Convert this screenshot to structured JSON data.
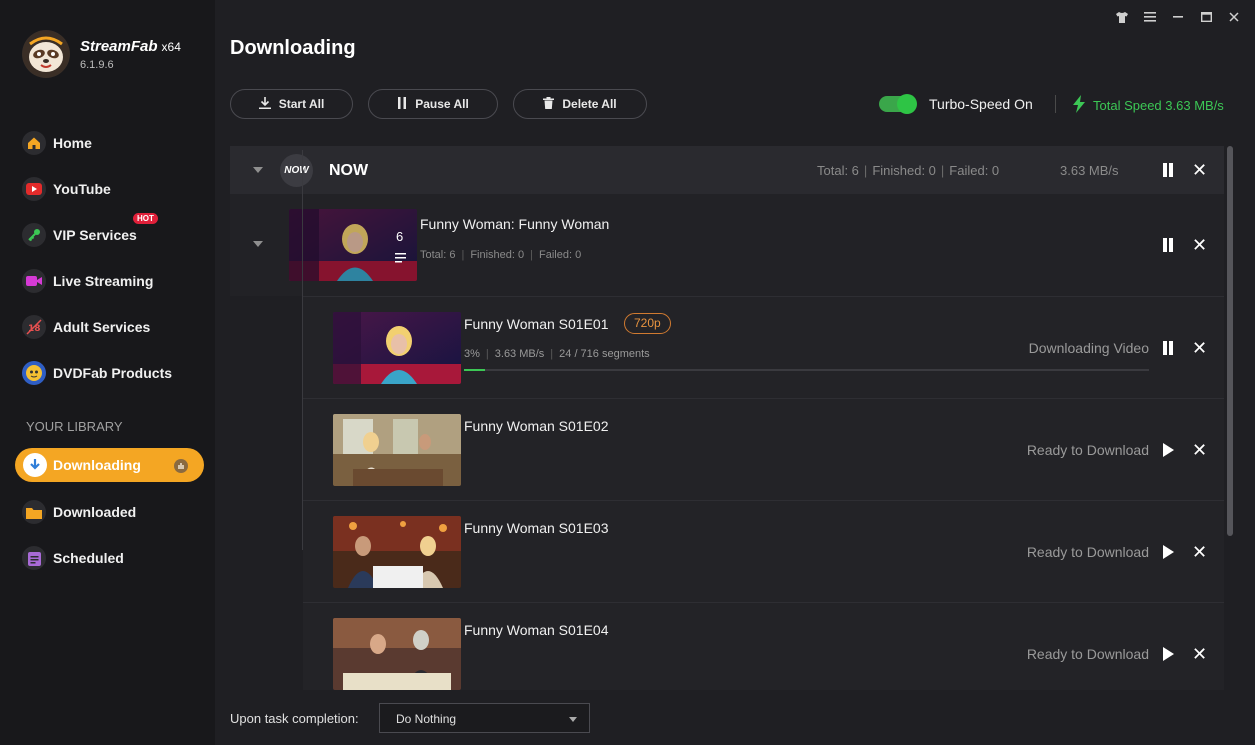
{
  "app": {
    "brand": "StreamFab",
    "arch": "x64",
    "version": "6.1.9.6"
  },
  "window_controls": [
    "shirt-icon",
    "menu-icon",
    "minimize-icon",
    "maximize-icon",
    "close-icon"
  ],
  "sidebar": {
    "items": [
      {
        "label": "Home",
        "icon": "home-icon"
      },
      {
        "label": "YouTube",
        "icon": "youtube-icon"
      },
      {
        "label": "VIP Services",
        "icon": "key-icon",
        "badge": "HOT"
      },
      {
        "label": "Live Streaming",
        "icon": "camera-icon"
      },
      {
        "label": "Adult Services",
        "icon": "adult-icon"
      },
      {
        "label": "DVDFab Products",
        "icon": "dvdfab-icon"
      }
    ],
    "library_title": "YOUR LIBRARY",
    "library": [
      {
        "label": "Downloading",
        "icon": "download-icon",
        "active": true
      },
      {
        "label": "Downloaded",
        "icon": "folder-icon"
      },
      {
        "label": "Scheduled",
        "icon": "calendar-icon"
      }
    ]
  },
  "main": {
    "title": "Downloading",
    "toolbar": {
      "start_all": "Start All",
      "pause_all": "Pause All",
      "delete_all": "Delete All"
    },
    "turbo_label": "Turbo-Speed On",
    "turbo_on": true,
    "total_speed": "Total Speed 3.63 MB/s"
  },
  "group": {
    "name": "NOW",
    "logo_text": "NOW",
    "total": "Total: 6",
    "finished": "Finished: 0",
    "failed": "Failed: 0",
    "speed": "3.63 MB/s"
  },
  "series": {
    "title": "Funny Woman: Funny Woman",
    "count": "6",
    "total": "Total: 6",
    "finished": "Finished: 0",
    "failed": "Failed: 0"
  },
  "episodes": [
    {
      "title": "Funny Woman S01E01",
      "quality": "720p",
      "percent": "3%",
      "speed": "3.63 MB/s",
      "segments": "24 / 716 segments",
      "progress": 0.03,
      "status": "Downloading Video",
      "action": "pause"
    },
    {
      "title": "Funny Woman S01E02",
      "status": "Ready to Download",
      "action": "play"
    },
    {
      "title": "Funny Woman S01E03",
      "status": "Ready to Download",
      "action": "play"
    },
    {
      "title": "Funny Woman S01E04",
      "status": "Ready to Download",
      "action": "play"
    }
  ],
  "footer": {
    "label": "Upon task completion:",
    "selected": "Do Nothing"
  },
  "colors": {
    "accent": "#f4a623",
    "green": "#3cc755",
    "badge": "#e89440",
    "hot": "#e0203a"
  }
}
